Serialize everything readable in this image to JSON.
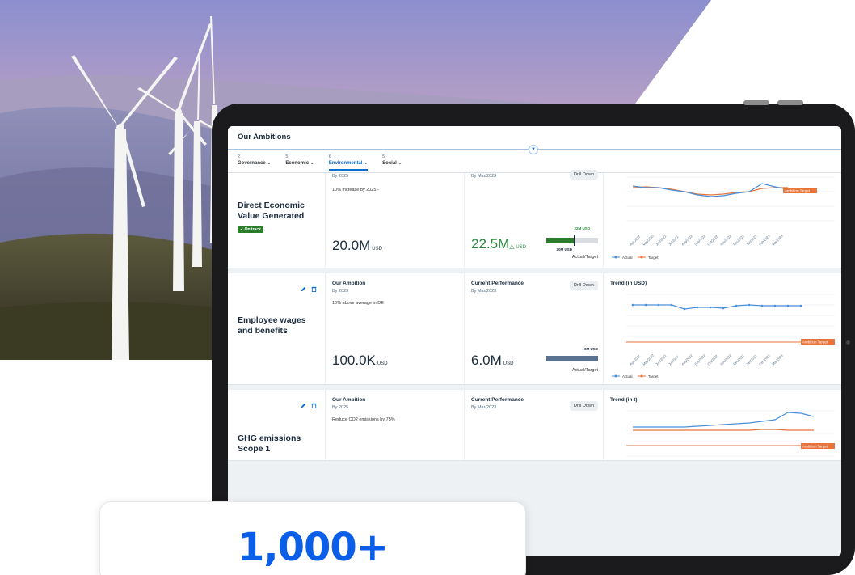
{
  "colors": {
    "accent": "#0a6ed1",
    "headline_number": "#0a5ee8",
    "on_track": "#2b7d2b",
    "actual_series": "#4a90d9",
    "target_series": "#e8743b",
    "ambition_target": "#e8743b"
  },
  "app": {
    "title": "Our Ambitions"
  },
  "tabs": [
    {
      "count": "2",
      "label": "Governance"
    },
    {
      "count": "5",
      "label": "Economic"
    },
    {
      "count": "6",
      "label": "Environmental",
      "active": true
    },
    {
      "count": "5",
      "label": "Social"
    }
  ],
  "cards": [
    {
      "name": "Direct Economic Value Generated",
      "status": "On track",
      "ambition": {
        "sub": "By 2025",
        "desc": "10% increase by 2025 -",
        "value": "20.0M",
        "unit": "USD"
      },
      "current": {
        "sub": "By Mar/2023",
        "value": "22.5M",
        "unit": "USD",
        "drill": "Drill Down",
        "bar_top": "22M USD",
        "bar_bottom": "20M USD",
        "bar_foot": "Actual/Target",
        "progress": 0.55
      },
      "trend": {
        "badge": "Ambition Target"
      },
      "legend": {
        "actual": "Actual",
        "target": "Target"
      }
    },
    {
      "name": "Employee wages and benefits",
      "ambition": {
        "title": "Our Ambition",
        "sub": "By 2023",
        "desc": "10% above average in DE",
        "value": "100.0K",
        "unit": "USD"
      },
      "current": {
        "title": "Current Performance",
        "sub": "By Mar/2023",
        "value": "6.0M",
        "unit": "USD",
        "drill": "Drill Down",
        "bar_top": "6M USD",
        "bar_foot": "Actual/Target",
        "progress": 1.0
      },
      "trend": {
        "title": "Trend (in USD)",
        "badge": "Ambition Target"
      },
      "legend": {
        "actual": "Actual",
        "target": "Target"
      }
    },
    {
      "name": "GHG emissions Scope 1",
      "ambition": {
        "title": "Our Ambition",
        "sub": "By 2025",
        "desc": "Reduce CO2 emissions by 75%"
      },
      "current": {
        "title": "Current Performance",
        "sub": "By Mar/2023",
        "drill": "Drill Down"
      },
      "trend": {
        "title": "Trend (in t)",
        "badge": "Ambition Target"
      }
    }
  ],
  "counter": {
    "value": "1,000+"
  }
}
